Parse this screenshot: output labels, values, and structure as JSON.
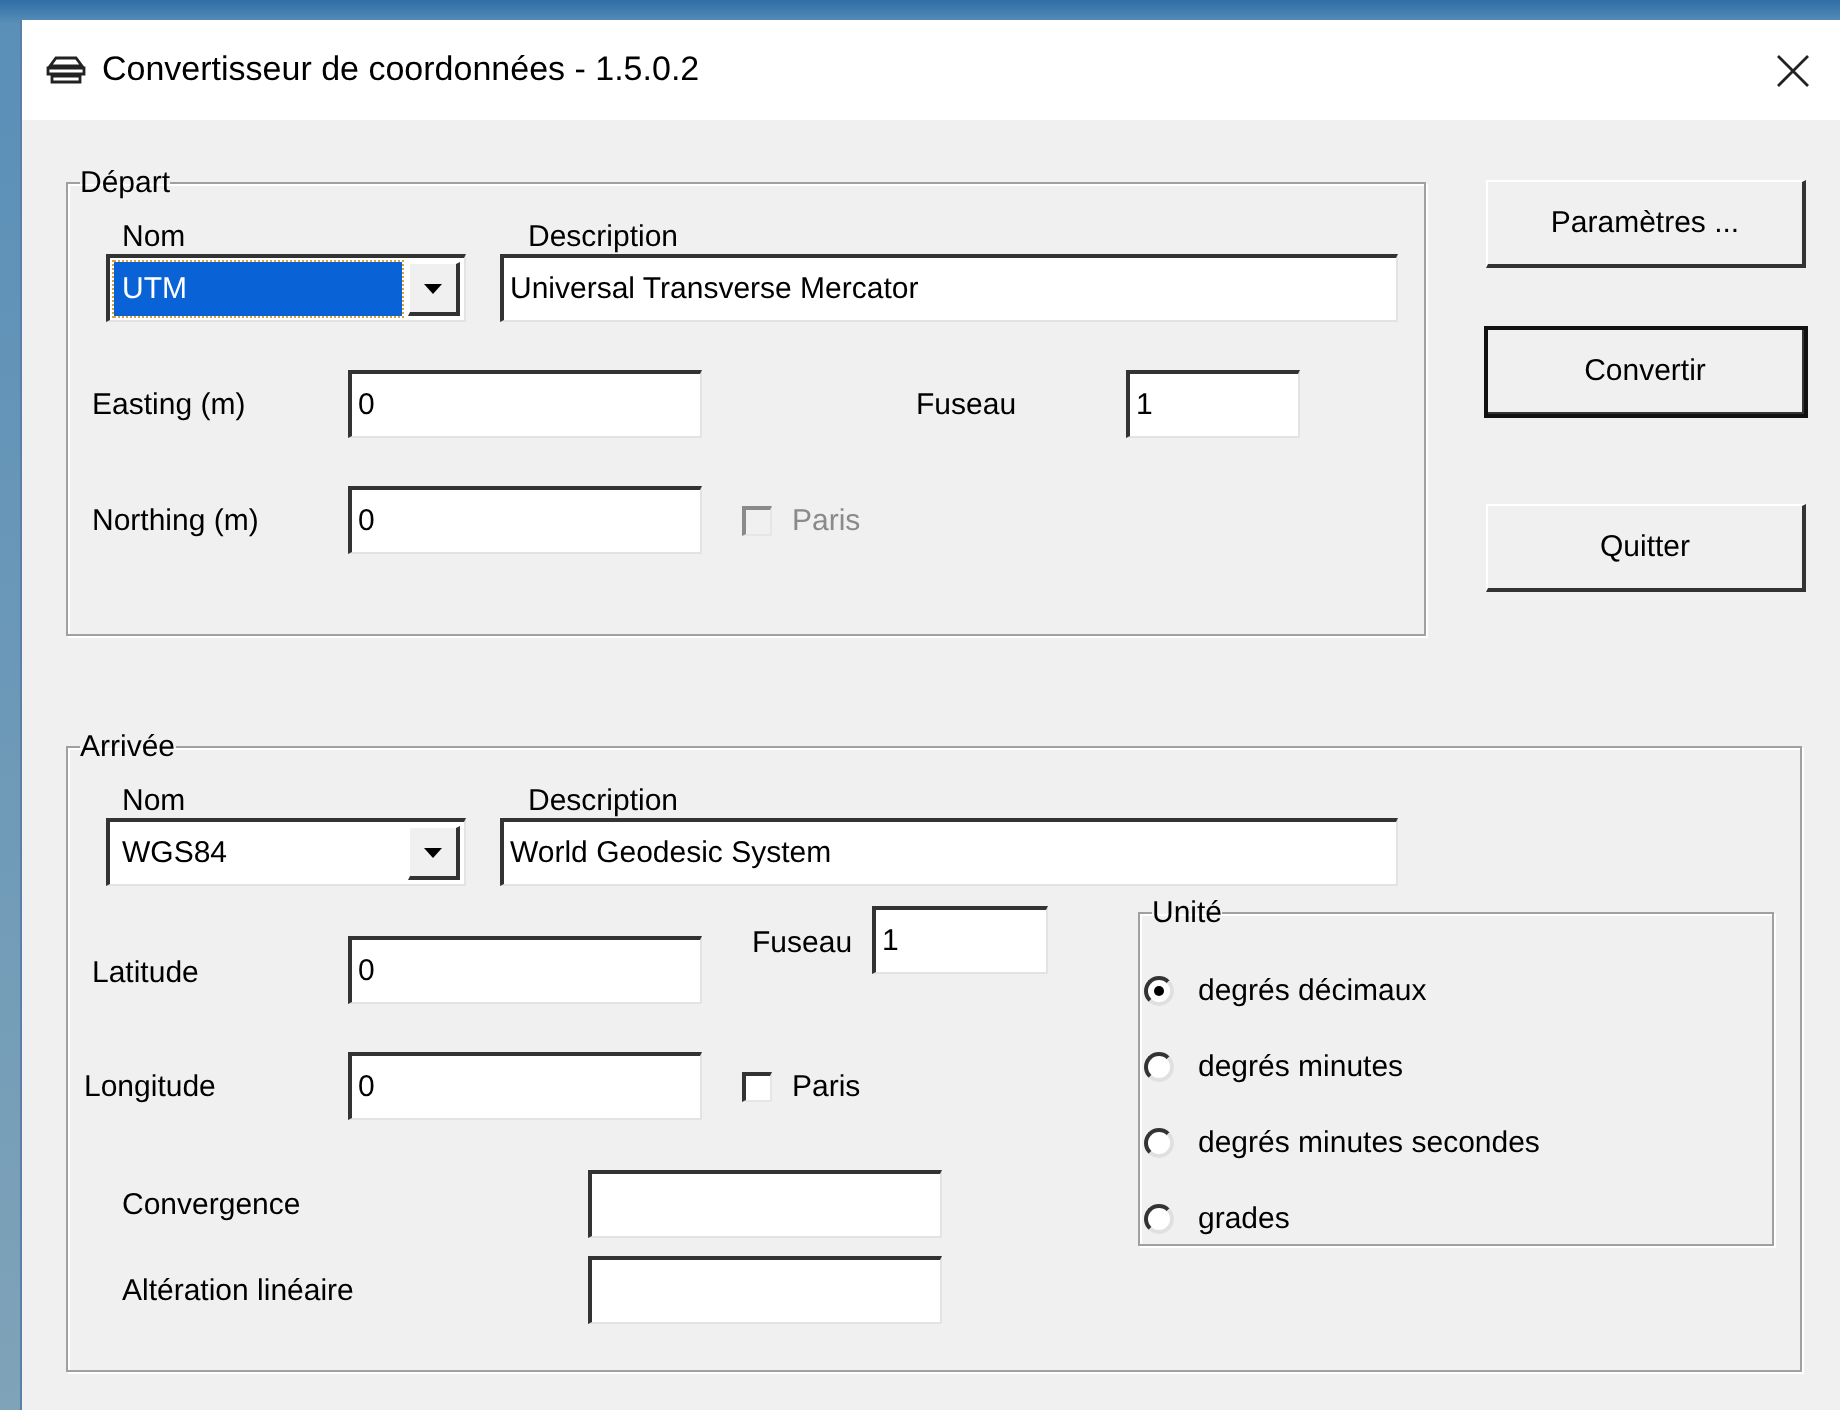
{
  "window": {
    "title": "Convertisseur de coordonnées - 1.5.0.2"
  },
  "departure": {
    "title": "Départ",
    "name_label": "Nom",
    "name": {
      "value": "UTM",
      "focused": true
    },
    "description_label": "Description",
    "description": "Universal Transverse Mercator",
    "easting": {
      "label": "Easting (m)",
      "value": "0"
    },
    "zone": {
      "label": "Fuseau",
      "value": "1"
    },
    "northing": {
      "label": "Northing (m)",
      "value": "0"
    },
    "paris": {
      "label": "Paris",
      "checked": false,
      "disabled": true
    }
  },
  "buttons": [
    {
      "label": "Paramètres ...",
      "default": false
    },
    {
      "label": "Convertir",
      "default": true
    },
    {
      "label": "Quitter",
      "default": false
    }
  ],
  "arrival": {
    "title": "Arrivée",
    "name_label": "Nom",
    "name": {
      "value": "WGS84",
      "focused": false
    },
    "description_label": "Description",
    "description": "World Geodesic System",
    "latitude": {
      "label": "Latitude",
      "value": "0"
    },
    "zone": {
      "label": "Fuseau",
      "value": "1"
    },
    "longitude": {
      "label": "Longitude",
      "value": "0"
    },
    "paris": {
      "label": "Paris",
      "checked": false,
      "disabled": false
    },
    "convergence": {
      "label": "Convergence"
    },
    "linear_alteration": {
      "label": "Altération linéaire"
    },
    "unit": {
      "title": "Unité",
      "options": [
        {
          "label": "degrés décimaux",
          "selected": true
        },
        {
          "label": "degrés minutes",
          "selected": false
        },
        {
          "label": "degrés minutes secondes",
          "selected": false
        },
        {
          "label": "grades",
          "selected": false
        }
      ]
    }
  }
}
